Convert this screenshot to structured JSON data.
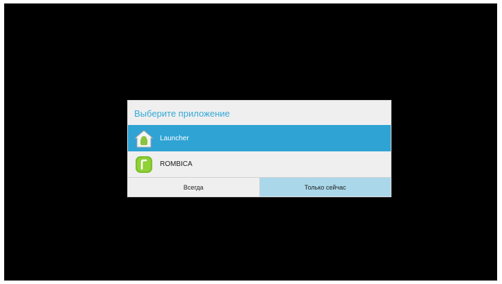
{
  "dialog": {
    "title": "Выберите приложение",
    "apps": [
      {
        "label": "Launcher",
        "icon": "launcher-home-icon",
        "selected": true
      },
      {
        "label": "ROMBICA",
        "icon": "rombica-app-icon",
        "selected": false
      }
    ],
    "buttons": {
      "always_label": "Всегда",
      "just_once_label": "Только сейчас"
    }
  },
  "colors": {
    "accent": "#2fa3d4",
    "title_text": "#33a8d6",
    "pressed_button": "#aad8ea",
    "dialog_bg": "#efeff0",
    "screen_bg": "#000000"
  }
}
